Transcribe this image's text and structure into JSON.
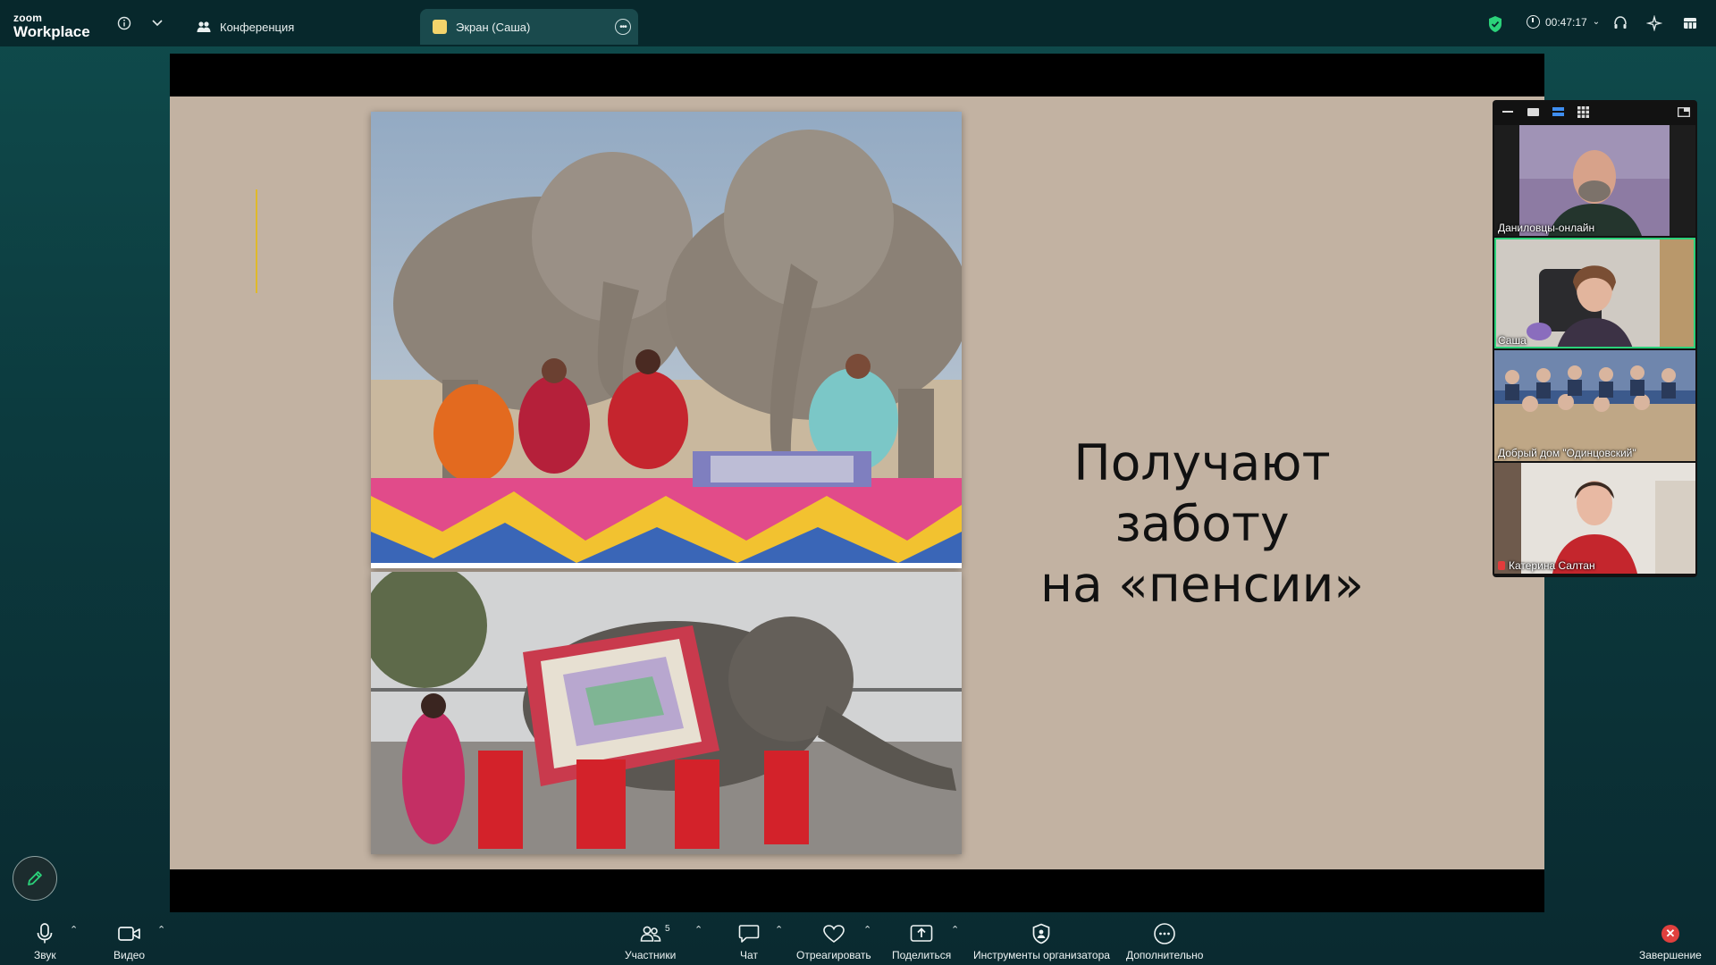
{
  "app": {
    "logo_small": "zoom",
    "logo_big": "Workplace"
  },
  "tabs": {
    "meeting": "Конференция",
    "share": "Экран (Саша)"
  },
  "timer": "00:47:17",
  "slide": {
    "title_line1": "Получают заботу",
    "title_line2": "на «пенсии»"
  },
  "participants_panel": [
    {
      "name": "Даниловцы-онлайн"
    },
    {
      "name": "Саша"
    },
    {
      "name": "Добрый дом \"Одинцовский\""
    },
    {
      "name": "Катерина Салтан",
      "muted": true
    }
  ],
  "toolbar": {
    "audio": "Звук",
    "video": "Видео",
    "participants": "Участники",
    "participants_count": "5",
    "chat": "Чат",
    "react": "Отреагировать",
    "share": "Поделиться",
    "host_tools": "Инструменты организатора",
    "more": "Дополнительно",
    "end": "Завершение"
  },
  "colors": {
    "background": "#0f4b4c",
    "topbar": "#07282c",
    "slide": "#c2b2a2",
    "active_speaker": "#2bd27a",
    "end_red": "#e0403e"
  }
}
